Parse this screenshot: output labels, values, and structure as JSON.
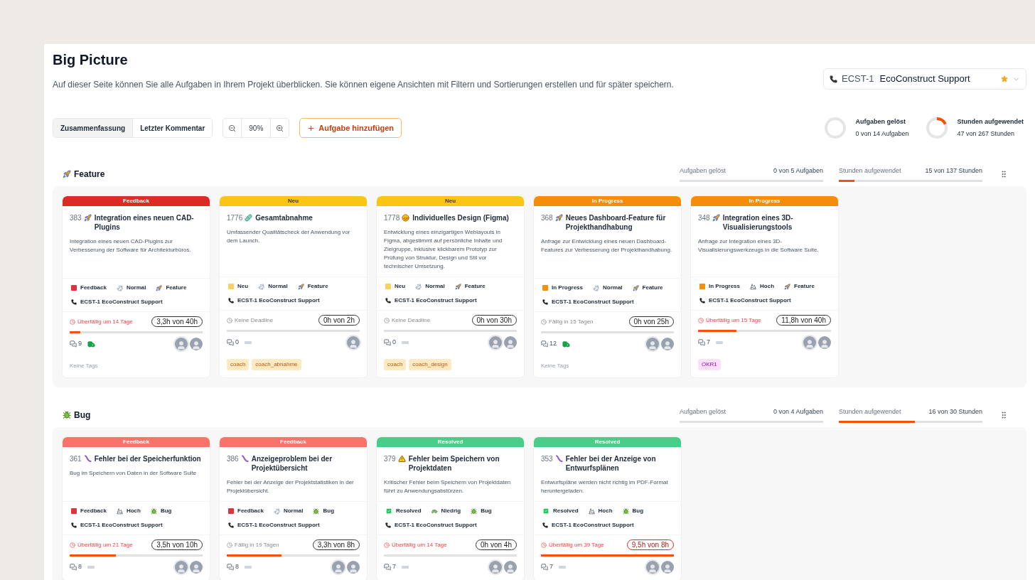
{
  "page": {
    "title": "Big Picture",
    "description": "Auf dieser Seite können Sie alle Aufgaben in Ihrem Projekt überblicken. Sie können eigene Ansichten mit Filtern und Sortierungen erstellen und für später speichern."
  },
  "project_select": {
    "code": "ECST-1",
    "name": "EcoConstruct Support",
    "favorite": true
  },
  "view_tabs": [
    {
      "label": "Zusammenfassung",
      "selected": true
    },
    {
      "label": "Letzter Kommentar",
      "selected": false
    }
  ],
  "zoom": {
    "value": "90%"
  },
  "add_button": "Aufgabe hinzufügen",
  "summary": [
    {
      "label": "Aufgaben gelöst",
      "value": "0 von 14 Aufgaben"
    },
    {
      "label": "Stunden aufgewendet",
      "value": "47 von 267 Stunden",
      "level": 0.18
    }
  ],
  "sections": [
    {
      "title": "Feature",
      "kind": "rocket",
      "stats": [
        {
          "label": "Aufgaben gelöst",
          "value": "0 von 5 Aufgaben"
        },
        {
          "label": "Stunden aufgewendet",
          "value": "15 von 137 Stunden",
          "level": 0.11
        }
      ],
      "cards": [
        {
          "header": {
            "label": "Feedback",
            "color": "#dc2b24"
          },
          "number": "383",
          "kind": "rocket",
          "title": "Integration eines neuen CAD-Plugins",
          "description": "Integration eines neuen CAD-Plugins zur Verbesserung der Software für Architekturbüros.",
          "status": {
            "label": "Feedback",
            "color": "#e0323f",
            "done": false
          },
          "priority": {
            "label": "Normal",
            "kind": "rabbit"
          },
          "type": {
            "label": "Feature",
            "kind": "rocket"
          },
          "project": "ECST-1 EcoConstruct Support",
          "deadline": {
            "label": "Überfällig um 14 Tage",
            "overdue": true
          },
          "hours": {
            "label": "3,3h von 40h",
            "over": false,
            "level": 0.08
          },
          "comments": "9",
          "linked": true,
          "avatars": [
            {
              "ring": true
            },
            {
              "ring": false
            }
          ],
          "no_tags": "Keine Tags"
        },
        {
          "header": {
            "label": "Neu",
            "color": "#fac515"
          },
          "number": "1776",
          "kind": "pill",
          "title": "Gesamtabnahme",
          "description": "Umfassender Qualitätscheck der Anwendung vor dem Launch.",
          "status": {
            "label": "Neu",
            "color": "#fcd060",
            "done": false
          },
          "priority": {
            "label": "Normal",
            "kind": "rabbit"
          },
          "type": {
            "label": "Feature",
            "kind": "rocket"
          },
          "project": "ECST-1 EcoConstruct Support",
          "deadline": {
            "label": "Keine Deadline",
            "overdue": false
          },
          "hours": {
            "label": "0h von 2h",
            "over": false
          },
          "comments": "0",
          "linked": false,
          "avatars": [
            {
              "ring": true
            }
          ],
          "tags": [
            {
              "label": "coach",
              "color": "#fde9c2"
            },
            {
              "label": "coach_abnahme",
              "color": "#fde9c2"
            }
          ]
        },
        {
          "header": {
            "label": "Neu",
            "color": "#fac515"
          },
          "number": "1778",
          "kind": "star-face",
          "title": "Individuelles Design (Figma)",
          "description": "Entwicklung eines einzigartigen Weblayouts in Figma, abgestimmt auf persönliche Inhalte und Zielgruppe, inklusive klickbarem Prototyp zur Prüfung von Struktur, Design und Stil vor technischer Umsetzung.",
          "status": {
            "label": "Neu",
            "color": "#fcd060",
            "done": false
          },
          "priority": {
            "label": "Normal",
            "kind": "rabbit"
          },
          "type": {
            "label": "Feature",
            "kind": "rocket"
          },
          "project": "ECST-1 EcoConstruct Support",
          "deadline": {
            "label": "Keine Deadline",
            "overdue": false
          },
          "hours": {
            "label": "0h von 30h",
            "over": false
          },
          "comments": "0",
          "linked": false,
          "avatars": [
            {
              "ring": true
            },
            {
              "ring": false
            }
          ],
          "tags": [
            {
              "label": "coach",
              "color": "#fde9c2"
            },
            {
              "label": "coach_design",
              "color": "#fde9c2"
            }
          ]
        },
        {
          "header": {
            "label": "In Progress",
            "color": "#f58d0b"
          },
          "number": "368",
          "kind": "rocket",
          "title": "Neues Dashboard-Feature für Projekthandhabung",
          "description": "Anfrage zur Entwicklung eines neuen Dashboard-Features zur Verbesserung der Projekthandhabung.",
          "status": {
            "label": "In Progress",
            "color": "#f5900b",
            "done": false
          },
          "priority": {
            "label": "Normal",
            "kind": "rabbit"
          },
          "type": {
            "label": "Feature",
            "kind": "rocket"
          },
          "project": "ECST-1 EcoConstruct Support",
          "deadline": {
            "label": "Fällig in 15 Tagen",
            "overdue": false
          },
          "hours": {
            "label": "0h von 25h",
            "over": false
          },
          "comments": "12",
          "linked": true,
          "avatars": [
            {
              "ring": true
            },
            {
              "ring": false
            }
          ],
          "no_tags": "Keine Tags"
        },
        {
          "header": {
            "label": "In Progress",
            "color": "#f58d0b"
          },
          "number": "348",
          "kind": "rocket",
          "title": "Integration eines 3D-Visualisierungstools",
          "description": "Anfrage zur Integration eines 3D-Visualisierungswerkzeugs in die Software Suite.",
          "status": {
            "label": "In Progress",
            "color": "#f5900b",
            "done": false
          },
          "priority": {
            "label": "Hoch",
            "kind": "mountain"
          },
          "type": {
            "label": "Feature",
            "kind": "rocket"
          },
          "project": "ECST-1 EcoConstruct Support",
          "deadline": {
            "label": "Überfällig um 15 Tage",
            "overdue": true
          },
          "hours": {
            "label": "11,8h von 40h",
            "over": false,
            "level": 0.29
          },
          "comments": "7",
          "linked": false,
          "avatars": [
            {
              "ring": true
            },
            {
              "ring": false
            }
          ],
          "tags": [
            {
              "label": "OKR1",
              "color": "#fbe0fb"
            }
          ]
        }
      ]
    },
    {
      "title": "Bug",
      "kind": "bug",
      "stats": [
        {
          "label": "Aufgaben gelöst",
          "value": "0 von 4 Aufgaben"
        },
        {
          "label": "Stunden aufgewendet",
          "value": "16 von 30 Stunden",
          "level": 0.53
        }
      ],
      "cards": [
        {
          "header": {
            "label": "Feedback",
            "color": "#f8736a"
          },
          "number": "361",
          "kind": "worm",
          "title": "Fehler bei der Speicherfunktion",
          "description": "Bug im Speichern von Daten in der Software Suite",
          "status": {
            "label": "Feedback",
            "color": "#e0323f",
            "done": false
          },
          "priority": {
            "label": "Hoch",
            "kind": "mountain"
          },
          "type": {
            "label": "Bug",
            "kind": "bug"
          },
          "project": "ECST-1 EcoConstruct Support",
          "deadline": {
            "label": "Überfällig um 21 Tage",
            "overdue": true
          },
          "hours": {
            "label": "3,5h von 10h",
            "over": false,
            "level": 0.35
          },
          "comments": "8",
          "linked": false,
          "avatars": [
            {
              "ring": true
            },
            {
              "ring": false
            }
          ]
        },
        {
          "header": {
            "label": "Feedback",
            "color": "#f8736a"
          },
          "number": "386",
          "kind": "worm",
          "title": "Anzeigeproblem bei der Projektübersicht",
          "description": "Fehler bei der Anzeige der Projektstatistiken in der Projektübersicht.",
          "status": {
            "label": "Feedback",
            "color": "#e0323f",
            "done": false
          },
          "priority": {
            "label": "Normal",
            "kind": "rabbit"
          },
          "type": {
            "label": "Bug",
            "kind": "bug"
          },
          "project": "ECST-1 EcoConstruct Support",
          "deadline": {
            "label": "Fällig in 19 Tagen",
            "overdue": false
          },
          "hours": {
            "label": "3,3h von 8h",
            "over": false,
            "level": 0.41
          },
          "comments": "8",
          "linked": false,
          "avatars": [
            {
              "ring": true
            },
            {
              "ring": false
            }
          ]
        },
        {
          "header": {
            "label": "Resolved",
            "color": "#4acd88"
          },
          "number": "379",
          "kind": "warning",
          "title": "Fehler beim Speichern von Projektdaten",
          "description": "Kritischer Fehler beim Speichern von Projektdaten führt zu Anwendungsabstürzen.",
          "status": {
            "label": "Resolved",
            "color": "#22c55e",
            "done": true
          },
          "priority": {
            "label": "Niedrig",
            "kind": "turtle"
          },
          "type": {
            "label": "Bug",
            "kind": "bug"
          },
          "project": "ECST-1 EcoConstruct Support",
          "deadline": {
            "label": "Überfällig um 14 Tage",
            "overdue": true
          },
          "hours": {
            "label": "0h von 4h",
            "over": false
          },
          "comments": "7",
          "linked": false,
          "avatars": [
            {
              "ring": true
            },
            {
              "ring": false
            }
          ]
        },
        {
          "header": {
            "label": "Resolved",
            "color": "#4acd88"
          },
          "number": "353",
          "kind": "worm",
          "title": "Fehler bei der Anzeige von Entwurfsplänen",
          "description": "Entwurfspläne werden nicht richtig im PDF-Format heruntergeladen.",
          "status": {
            "label": "Resolved",
            "color": "#22c55e",
            "done": true
          },
          "priority": {
            "label": "Hoch",
            "kind": "mountain"
          },
          "type": {
            "label": "Bug",
            "kind": "bug"
          },
          "project": "ECST-1 EcoConstruct Support",
          "deadline": {
            "label": "Überfällig um 39 Tage",
            "overdue": true
          },
          "hours": {
            "label": "9,5h von 8h",
            "over": true,
            "level": 1
          },
          "comments": "7",
          "linked": false,
          "avatars": [
            {
              "ring": true
            },
            {
              "ring": false
            }
          ]
        }
      ]
    }
  ]
}
